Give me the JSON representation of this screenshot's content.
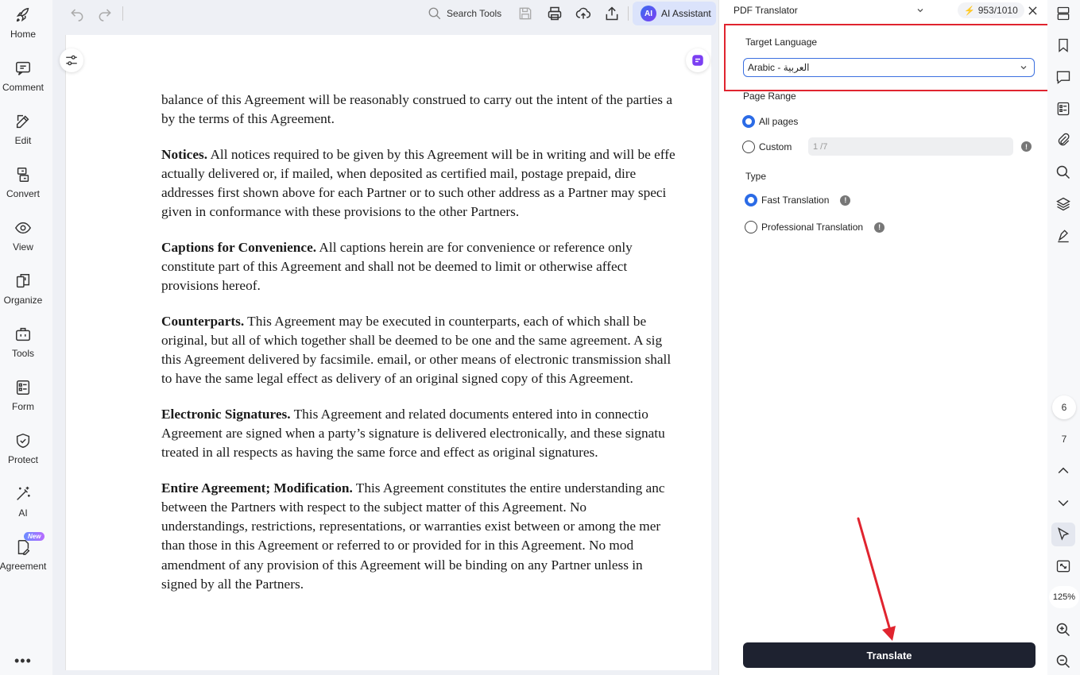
{
  "sidebar": {
    "items": [
      {
        "label": "Home",
        "icon": "rocket-icon"
      },
      {
        "label": "Comment",
        "icon": "comment-icon"
      },
      {
        "label": "Edit",
        "icon": "edit-icon"
      },
      {
        "label": "Convert",
        "icon": "convert-icon"
      },
      {
        "label": "View",
        "icon": "eye-icon"
      },
      {
        "label": "Organize",
        "icon": "organize-icon"
      },
      {
        "label": "Tools",
        "icon": "toolbox-icon"
      },
      {
        "label": "Form",
        "icon": "form-icon"
      },
      {
        "label": "Protect",
        "icon": "shield-icon"
      },
      {
        "label": "AI",
        "icon": "magic-wand-icon"
      },
      {
        "label": "Agreement",
        "icon": "agreement-icon",
        "badge": "New"
      }
    ],
    "more": "•••"
  },
  "toolbar": {
    "search_label": "Search Tools",
    "ai_badge": "AI",
    "ai_label": "AI Assistant"
  },
  "document": {
    "paragraphs": [
      {
        "lines": [
          {
            "text": "balance of this Agreement will be reasonably construed to carry out the intent of the parties a"
          },
          {
            "text": "by the terms of this Agreement."
          }
        ]
      },
      {
        "lines": [
          {
            "bold": "Notices.",
            "text": " All notices required to be given by this Agreement will be in writing and will be effe"
          },
          {
            "text": "actually delivered or, if mailed, when deposited as certified mail, postage prepaid, dire"
          },
          {
            "text": "addresses first shown above for each Partner or to such other address as a Partner may speci"
          },
          {
            "text": "given in conformance with these provisions to the other Partners."
          }
        ]
      },
      {
        "lines": [
          {
            "bold": "Captions for Convenience.",
            "text": " All captions herein are for convenience or reference only"
          },
          {
            "text": "constitute part of this Agreement and shall not be deemed to limit or otherwise affect"
          },
          {
            "text": "provisions hereof."
          }
        ]
      },
      {
        "lines": [
          {
            "bold": "Counterparts.",
            "text": " This Agreement may be executed in counterparts, each of which shall be"
          },
          {
            "text": "original, but all of which together shall be deemed to be one and the same agreement. A sig"
          },
          {
            "text": "this Agreement delivered by facsimile. email, or other means of electronic transmission shall"
          },
          {
            "text": "to have the same legal effect as delivery of an original signed copy of this Agreement."
          }
        ]
      },
      {
        "lines": [
          {
            "bold": "Electronic Signatures.",
            "text": " This Agreement and related documents entered into in connectio"
          },
          {
            "text": "Agreement are signed when a party’s signature is delivered electronically, and these signatu"
          },
          {
            "text": "treated in all respects as having the same force and effect as original signatures."
          }
        ]
      },
      {
        "lines": [
          {
            "bold": "Entire Agreement; Modification.",
            "text": " This Agreement constitutes the entire understanding anc"
          },
          {
            "text": "between the Partners with respect to the subject matter of this Agreement. No"
          },
          {
            "text": "understandings, restrictions, representations, or warranties exist between or among the mer"
          },
          {
            "text": "than those in this Agreement or referred to or provided for in this Agreement. No mod"
          },
          {
            "text": "amendment of any provision of this Agreement will be binding on any Partner unless in"
          },
          {
            "text": "signed by all the Partners."
          }
        ]
      }
    ]
  },
  "translator": {
    "title": "PDF Translator",
    "credits": "953/1010",
    "target_language_label": "Target Language",
    "target_language_value": "Arabic - العربية",
    "page_range_label": "Page Range",
    "all_pages_label": "All pages",
    "custom_label": "Custom",
    "custom_placeholder": "1 /7",
    "type_label": "Type",
    "fast_label": "Fast Translation",
    "professional_label": "Professional Translation",
    "translate_button": "Translate",
    "page_range_selected": "All pages",
    "type_selected": "Fast Translation"
  },
  "right_strip": {
    "page_current": "6",
    "page_next": "7",
    "zoom": "125%"
  },
  "colors": {
    "accent": "#2b6be6",
    "highlight_box": "#e0242f",
    "annotation_arrow": "#e0242f",
    "translate_button_bg": "#1e2230"
  }
}
